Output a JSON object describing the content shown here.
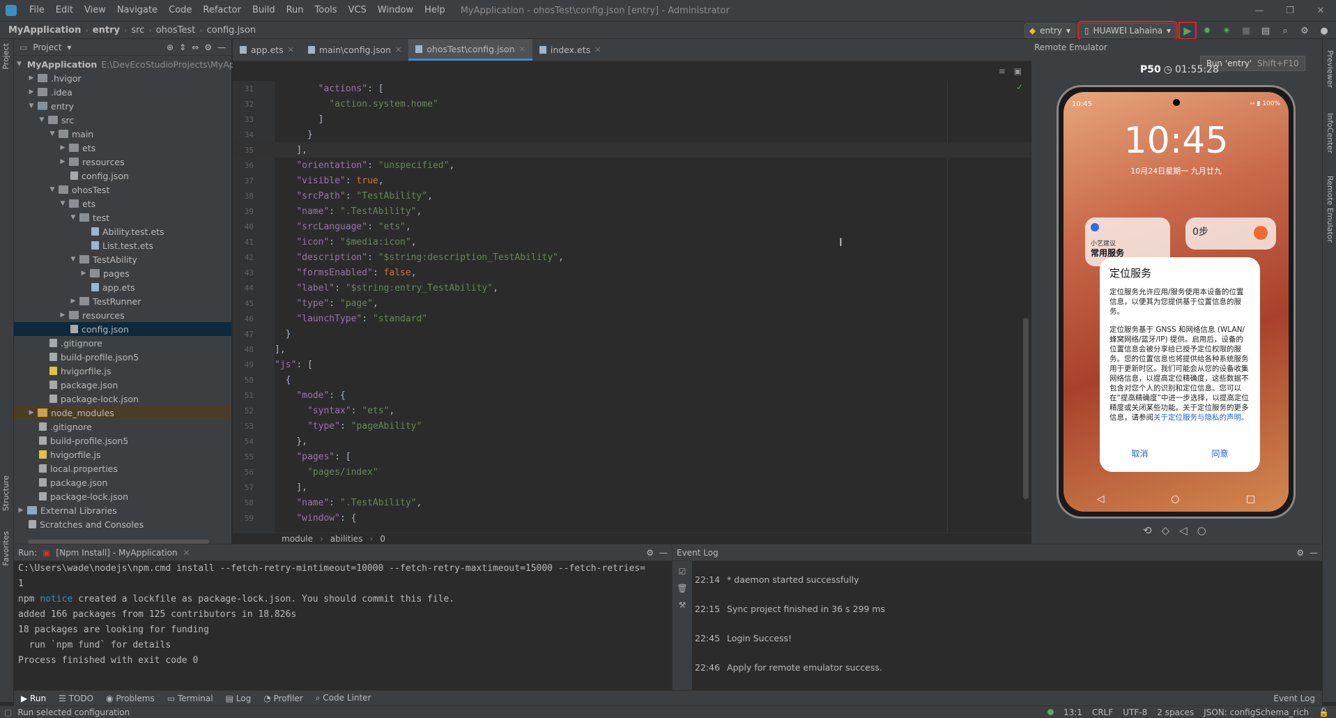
{
  "menu": {
    "items": [
      "File",
      "Edit",
      "View",
      "Navigate",
      "Code",
      "Refactor",
      "Build",
      "Run",
      "Tools",
      "VCS",
      "Window",
      "Help"
    ],
    "window_title": "MyApplication - ohosTest\\config.json [entry] - Administrator"
  },
  "breadcrumb": [
    "MyApplication",
    "entry",
    "src",
    "ohosTest",
    "config.json"
  ],
  "toolbar": {
    "config": "entry",
    "device": "HUAWEI Lahaina",
    "run_tooltip": "Run 'entry'",
    "run_shortcut": "Shift+F10"
  },
  "project": {
    "title": "Project",
    "root_path": "E:\\DevEcoStudioProjects\\MyAp",
    "tree": [
      {
        "label": "MyApplication",
        "indent": 0,
        "arrow": "▼",
        "icon": "module",
        "bold": true
      },
      {
        "label": ".hvigor",
        "indent": 1,
        "arrow": "▶",
        "icon": "folder"
      },
      {
        "label": ".idea",
        "indent": 1,
        "arrow": "▶",
        "icon": "folder"
      },
      {
        "label": "entry",
        "indent": 1,
        "arrow": "▼",
        "icon": "module"
      },
      {
        "label": "src",
        "indent": 2,
        "arrow": "▼",
        "icon": "folder"
      },
      {
        "label": "main",
        "indent": 3,
        "arrow": "▼",
        "icon": "folder"
      },
      {
        "label": "ets",
        "indent": 4,
        "arrow": "▶",
        "icon": "folder"
      },
      {
        "label": "resources",
        "indent": 4,
        "arrow": "▶",
        "icon": "folder"
      },
      {
        "label": "config.json",
        "indent": 4,
        "arrow": "",
        "icon": "json"
      },
      {
        "label": "ohosTest",
        "indent": 3,
        "arrow": "▼",
        "icon": "folder"
      },
      {
        "label": "ets",
        "indent": 4,
        "arrow": "▼",
        "icon": "folder"
      },
      {
        "label": "test",
        "indent": 5,
        "arrow": "▼",
        "icon": "folder"
      },
      {
        "label": "Ability.test.ets",
        "indent": 6,
        "arrow": "",
        "icon": "ets"
      },
      {
        "label": "List.test.ets",
        "indent": 6,
        "arrow": "",
        "icon": "ets"
      },
      {
        "label": "TestAbility",
        "indent": 5,
        "arrow": "▼",
        "icon": "folder"
      },
      {
        "label": "pages",
        "indent": 6,
        "arrow": "▶",
        "icon": "folder"
      },
      {
        "label": "app.ets",
        "indent": 6,
        "arrow": "",
        "icon": "ets"
      },
      {
        "label": "TestRunner",
        "indent": 5,
        "arrow": "▶",
        "icon": "folder"
      },
      {
        "label": "resources",
        "indent": 4,
        "arrow": "▶",
        "icon": "folder"
      },
      {
        "label": "config.json",
        "indent": 4,
        "arrow": "",
        "icon": "json",
        "selected": true
      },
      {
        "label": ".gitignore",
        "indent": 2,
        "arrow": "",
        "icon": "file"
      },
      {
        "label": "build-profile.json5",
        "indent": 2,
        "arrow": "",
        "icon": "file"
      },
      {
        "label": "hvigorfile.js",
        "indent": 2,
        "arrow": "",
        "icon": "js"
      },
      {
        "label": "package.json",
        "indent": 2,
        "arrow": "",
        "icon": "json"
      },
      {
        "label": "package-lock.json",
        "indent": 2,
        "arrow": "",
        "icon": "json"
      },
      {
        "label": "node_modules",
        "indent": 1,
        "arrow": "▶",
        "icon": "nm",
        "nm": true
      },
      {
        "label": ".gitignore",
        "indent": 1,
        "arrow": "",
        "icon": "file"
      },
      {
        "label": "build-profile.json5",
        "indent": 1,
        "arrow": "",
        "icon": "file"
      },
      {
        "label": "hvigorfile.js",
        "indent": 1,
        "arrow": "",
        "icon": "js"
      },
      {
        "label": "local.properties",
        "indent": 1,
        "arrow": "",
        "icon": "file"
      },
      {
        "label": "package.json",
        "indent": 1,
        "arrow": "",
        "icon": "json"
      },
      {
        "label": "package-lock.json",
        "indent": 1,
        "arrow": "",
        "icon": "json"
      },
      {
        "label": "External Libraries",
        "indent": 0,
        "arrow": "▶",
        "icon": "lib"
      },
      {
        "label": "Scratches and Consoles",
        "indent": 0,
        "arrow": "",
        "icon": "file"
      }
    ]
  },
  "editor": {
    "tabs": [
      {
        "label": "app.ets",
        "active": false
      },
      {
        "label": "main\\config.json",
        "active": false
      },
      {
        "label": "ohosTest\\config.json",
        "active": true
      },
      {
        "label": "index.ets",
        "active": false
      }
    ],
    "lines": [
      {
        "n": "31",
        "html": "        <span class='k'>\"actions\"</span>: [",
        "current": false
      },
      {
        "n": "32",
        "html": "          <span class='s'>\"action.system.home\"</span>",
        "current": false
      },
      {
        "n": "33",
        "html": "        ]",
        "current": false
      },
      {
        "n": "34",
        "html": "      }",
        "current": false
      },
      {
        "n": "35",
        "html": "    ],",
        "current": true
      },
      {
        "n": "36",
        "html": "    <span class='k'>\"orientation\"</span>: <span class='s'>\"unspecified\"</span>,",
        "current": false
      },
      {
        "n": "37",
        "html": "    <span class='k'>\"visible\"</span>: <span class='b'>true</span>,",
        "current": false
      },
      {
        "n": "38",
        "html": "    <span class='k'>\"srcPath\"</span>: <span class='s'>\"TestAbility\"</span>,",
        "current": false
      },
      {
        "n": "39",
        "html": "    <span class='k'>\"name\"</span>: <span class='s'>\".TestAbility\"</span>,",
        "current": false
      },
      {
        "n": "40",
        "html": "    <span class='k'>\"srcLanguage\"</span>: <span class='s'>\"ets\"</span>,",
        "current": false
      },
      {
        "n": "41",
        "html": "    <span class='k'>\"icon\"</span>: <span class='s'>\"$media:icon\"</span>,",
        "current": false
      },
      {
        "n": "42",
        "html": "    <span class='k'>\"description\"</span>: <span class='s'>\"$string:description_TestAbility\"</span>,",
        "current": false
      },
      {
        "n": "43",
        "html": "    <span class='k'>\"formsEnabled\"</span>: <span class='b'>false</span>,",
        "current": false
      },
      {
        "n": "44",
        "html": "    <span class='k'>\"label\"</span>: <span class='s'>\"$string:entry_TestAbility\"</span>,",
        "current": false
      },
      {
        "n": "45",
        "html": "    <span class='k'>\"type\"</span>: <span class='s'>\"page\"</span>,",
        "current": false
      },
      {
        "n": "46",
        "html": "    <span class='k'>\"launchType\"</span>: <span class='s'>\"standard\"</span>",
        "current": false
      },
      {
        "n": "47",
        "html": "  }",
        "current": false
      },
      {
        "n": "48",
        "html": "],",
        "current": false
      },
      {
        "n": "49",
        "html": "<span class='k'>\"js\"</span>: [",
        "current": false
      },
      {
        "n": "50",
        "html": "  {",
        "current": false
      },
      {
        "n": "51",
        "html": "    <span class='k'>\"mode\"</span>: {",
        "current": false
      },
      {
        "n": "52",
        "html": "      <span class='k'>\"syntax\"</span>: <span class='s'>\"ets\"</span>,",
        "current": false
      },
      {
        "n": "53",
        "html": "      <span class='k'>\"type\"</span>: <span class='s'>\"pageAbility\"</span>",
        "current": false
      },
      {
        "n": "54",
        "html": "    },",
        "current": false
      },
      {
        "n": "55",
        "html": "    <span class='k'>\"pages\"</span>: [",
        "current": false
      },
      {
        "n": "56",
        "html": "      <span class='s'>\"pages/index\"</span>",
        "current": false
      },
      {
        "n": "57",
        "html": "    ],",
        "current": false
      },
      {
        "n": "58",
        "html": "    <span class='k'>\"name\"</span>: <span class='s'>\".TestAbility\"</span>,",
        "current": false
      },
      {
        "n": "59",
        "html": "    <span class='k'>\"window\"</span>: {",
        "current": false
      }
    ],
    "status_crumbs": [
      "module",
      "abilities",
      "0"
    ]
  },
  "emulator": {
    "title": "Remote Emulator",
    "device": "P50",
    "timer": "01:55:28",
    "status_time": "10:45",
    "battery": "100%",
    "clock": "10:45",
    "date": "10月24日星期一 九月廿九",
    "widget_small": "小艺建议",
    "widget_title": "常用服务",
    "steps": "0步",
    "dialog": {
      "title": "定位服务",
      "p1": "定位服务允许应用/服务使用本设备的位置信息，以便其为您提供基于位置信息的服务。",
      "p2": "定位服务基于 GNSS 和网络信息 (WLAN/蜂窝网络/蓝牙/IP) 提供。启用后，设备的位置信息会被分享给已授予定位权限的服务。您的位置信息也将提供给各种系统服务用于更新时区。我们可能会从您的设备收集网络信息，以提高定位精确度，这些数据不包含对您个人的识别和定位信息。您可以在“提高精确度”中进一步选择，以提高定位精度或关闭某些功能。关于定位服务的更多信息，请参阅",
      "link": "关于定位服务与隐私的声明。",
      "cancel": "取消",
      "agree": "同意"
    }
  },
  "run_panel": {
    "label": "Run:",
    "tab": "[Npm Install] - MyApplication",
    "lines": [
      "C:\\Users\\wade\\nodejs\\npm.cmd install --fetch-retry-mintimeout=10000 --fetch-retry-maxtimeout=15000 --fetch-retries=",
      "1",
      "npm |notice| created a lockfile as package-lock.json. You should commit this file.",
      "added 166 packages from 125 contributors in 18.826s",
      "18 packages are looking for funding",
      "  run `npm fund` for details",
      "Process finished with exit code 0"
    ]
  },
  "event_log": {
    "title": "Event Log",
    "entries": [
      {
        "time": "22:14",
        "msg": "* daemon started successfully"
      },
      {
        "time": "22:15",
        "msg": "Sync project finished in 36 s 299 ms"
      },
      {
        "time": "22:45",
        "msg": "Login Success!"
      },
      {
        "time": "22:46",
        "msg": "Apply for remote emulator success."
      }
    ]
  },
  "bottom_tabs": [
    "Run",
    "TODO",
    "Problems",
    "Terminal",
    "Log",
    "Profiler",
    "Code Linter"
  ],
  "bottom_right": "Event Log",
  "status": {
    "left": "Run selected configuration",
    "position": "13:1",
    "line_sep": "CRLF",
    "encoding": "UTF-8",
    "indent": "2 spaces",
    "schema": "JSON: configSchema_rich"
  },
  "side_labels": {
    "left": [
      "Project",
      "Structure",
      "Favorites"
    ],
    "right": [
      "Previewer",
      "InfoCenter",
      "Remote Emulator"
    ]
  }
}
